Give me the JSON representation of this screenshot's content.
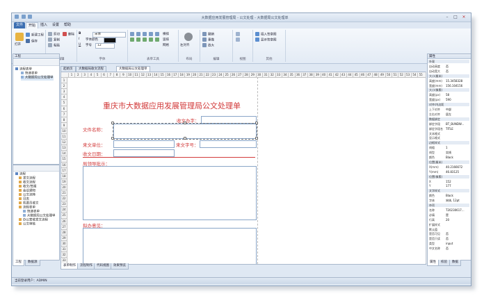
{
  "window": {
    "title": "大数据应用发展管理局 - 公文处理 - 大数据局公文处理单",
    "minimize_glyph": "–",
    "maximize_glyph": "□",
    "close_glyph": "×"
  },
  "ribbon_tabs": [
    "文件",
    "开始",
    "插入",
    "设置",
    "帮助"
  ],
  "ribbon": {
    "groups": [
      {
        "label": "文件"
      },
      {
        "label": "编辑"
      },
      {
        "label": "字体"
      },
      {
        "label": "表单工具"
      },
      {
        "label": "布局"
      },
      {
        "label": "编辑"
      },
      {
        "label": "视图"
      },
      {
        "label": "其他"
      }
    ],
    "file_items": [
      "新建工程",
      "保存",
      "打开"
    ],
    "edit_items": [
      "剪切",
      "复制",
      "粘贴",
      "删除"
    ],
    "font_name": "宋体",
    "font_color_label": "字体颜色",
    "font_size_label": "字号",
    "font_size": "12",
    "layout_items": [
      "左对齐",
      "居中",
      "右对齐"
    ],
    "grid_items": [
      "横排",
      "竖排",
      "网格"
    ],
    "edit2_items": [
      "撤销",
      "重做",
      "放大"
    ],
    "other_items": [
      "插入签章图",
      "显示签章图"
    ]
  },
  "left_panel": {
    "top_title": "工程",
    "tree_top": [
      "流程表单",
      "快递表单",
      "大数据局公文处理单"
    ],
    "tree_bottom": [
      "流程",
      "发文流程",
      "收文流程",
      "收文/签报",
      "会议通知",
      "公文流转",
      "日志",
      "机要员收文",
      "流程表单",
      "快递表单",
      "大数据局公文处理单",
      "办公室收发文流程",
      "公文审核"
    ],
    "bottom_tabs": [
      "工程",
      "数据源"
    ]
  },
  "doc_tabs": [
    "起始页",
    "大数据局收文流程",
    "大数据局公文处理单"
  ],
  "ruler_numbers": [
    "1",
    "2",
    "3",
    "4",
    "5",
    "6",
    "7",
    "8",
    "9",
    "10",
    "11",
    "12",
    "13",
    "14",
    "15",
    "16",
    "17",
    "18",
    "19",
    "20",
    "21",
    "22",
    "23",
    "24",
    "25",
    "26",
    "27",
    "28",
    "29",
    "30",
    "31",
    "32",
    "33",
    "34",
    "35",
    "36",
    "37",
    "38",
    "39",
    "40",
    "41",
    "42",
    "43",
    "44",
    "45",
    "46",
    "47",
    "48",
    "49",
    "50",
    "51",
    "52",
    "53",
    "54",
    "55"
  ],
  "row_numbers": [
    "1",
    "2",
    "3",
    "4",
    "5",
    "6",
    "7",
    "8",
    "9",
    "10",
    "11",
    "12",
    "13",
    "14",
    "15",
    "16",
    "17",
    "18",
    "19",
    "20",
    "21",
    "22",
    "23",
    "24",
    "25",
    "26",
    "27",
    "28",
    "29",
    "30",
    "31",
    "32",
    "33"
  ],
  "form": {
    "title": "重庆市大数据应用发展管理局公文处理单",
    "field_receive_no": "收文办字：",
    "field_doc_name": "文件名称：",
    "field_from_unit": "来文单位：",
    "field_doc_no": "来文字号：",
    "field_receive_date": "收文日期：",
    "field_leader_opinion": "局领导批示：",
    "field_handle_opinion": "拟办意见："
  },
  "bottom_tabs": [
    "表单制作",
    "流程制作",
    "代码视图",
    "效果预览"
  ],
  "properties": {
    "title": "属性",
    "rows": [
      {
        "k": "外观",
        "v": "",
        "cat": true
      },
      {
        "k": "自动高度",
        "v": "否"
      },
      {
        "k": "自动宽大",
        "v": "否"
      },
      {
        "k": "大小(厘米)",
        "v": "",
        "cat": true
      },
      {
        "k": "高度(mm)",
        "v": "15.3458328"
      },
      {
        "k": "宽度(mm)",
        "v": "156.104156"
      },
      {
        "k": "大小(像素)",
        "v": "",
        "cat": true
      },
      {
        "k": "高度(px)",
        "v": "58"
      },
      {
        "k": "宽度(px)",
        "v": "590"
      },
      {
        "k": "对齐/内边距",
        "v": "",
        "cat": true
      },
      {
        "k": "上下对齐",
        "v": "中部"
      },
      {
        "k": "左右对齐",
        "v": "居左"
      },
      {
        "k": "数据绑定",
        "v": "",
        "cat": true
      },
      {
        "k": "绑定字段",
        "v": "BT_BUNDW..."
      },
      {
        "k": "绑定字段名",
        "v": "TITLE"
      },
      {
        "k": "文本格式",
        "v": ""
      },
      {
        "k": "显示格式",
        "v": ""
      },
      {
        "k": "边框样式",
        "v": "",
        "cat": true
      },
      {
        "k": "线粗",
        "v": "1"
      },
      {
        "k": "线型",
        "v": "实线"
      },
      {
        "k": "颜色",
        "v": "Black"
      },
      {
        "k": "位置(厘米)",
        "v": "",
        "cat": true
      },
      {
        "k": "X(mm)",
        "v": "40.2166672"
      },
      {
        "k": "Y(mm)",
        "v": "46.83125"
      },
      {
        "k": "位置(像素)",
        "v": "",
        "cat": true
      },
      {
        "k": "X",
        "v": "152"
      },
      {
        "k": "Y",
        "v": "177"
      },
      {
        "k": "文字样式",
        "v": "",
        "cat": true
      },
      {
        "k": "颜色",
        "v": "Black"
      },
      {
        "k": "字体",
        "v": "宋体, 12pt"
      },
      {
        "k": "杂项",
        "v": "",
        "cat": true
      },
      {
        "k": "名称",
        "v": "T20230617..."
      },
      {
        "k": "必填",
        "v": "是"
      },
      {
        "k": "行高",
        "v": "20"
      },
      {
        "k": "扩展样式",
        "v": ""
      },
      {
        "k": "默认值",
        "v": ""
      },
      {
        "k": "是否可见",
        "v": "否"
      },
      {
        "k": "是否只读",
        "v": "否"
      },
      {
        "k": "类型",
        "v": "input"
      },
      {
        "k": "中文名称",
        "v": "否"
      }
    ],
    "bottom_tabs": [
      "属性",
      "校验",
      "数据"
    ]
  },
  "status": "当前登录用户：ADMIN"
}
